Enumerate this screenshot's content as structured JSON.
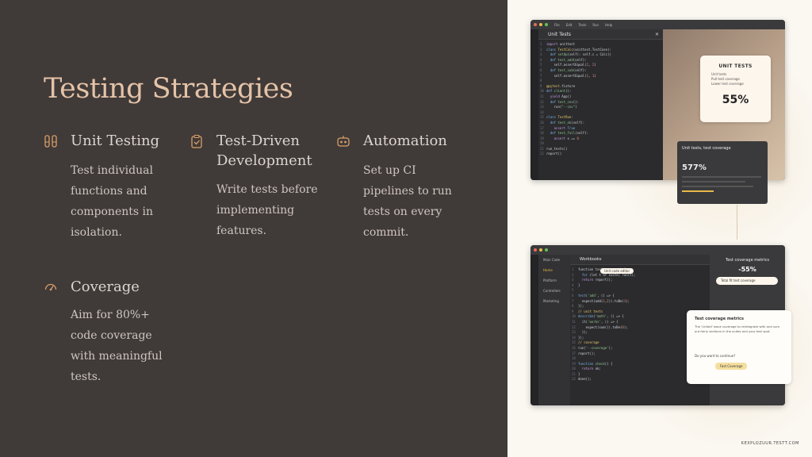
{
  "slide": {
    "title": "Testing Strategies",
    "features": [
      {
        "icon": "test-tubes-icon",
        "title": "Unit Testing",
        "lines": [
          "Test individual",
          "functions and",
          "components in",
          "isolation."
        ]
      },
      {
        "icon": "clipboard-check-icon",
        "title": "Test-Driven Development",
        "lines": [
          "Write tests before",
          "implementing",
          "features."
        ]
      },
      {
        "icon": "robot-icon",
        "title": "Automation",
        "lines": [
          "Set up CI",
          "pipelines to run",
          "tests on every",
          "commit."
        ]
      },
      {
        "icon": "gauge-icon",
        "title": "Coverage",
        "lines": [
          "Aim for 80%+",
          "code coverage",
          "with meaningful",
          "tests."
        ]
      }
    ]
  },
  "screenshot_top": {
    "menu": [
      "File",
      "Edit",
      "Tests",
      "Run",
      "Help"
    ],
    "panel_title": "Unit Tests",
    "coverage_card": {
      "title": "UNIT TESTS",
      "items": [
        "Unit tests",
        "Pull test coverage",
        "Lower test coverage"
      ],
      "value": "55%"
    },
    "tooltip": {
      "text": "Unit tests, test coverage",
      "value": "577%"
    }
  },
  "screenshot_bottom": {
    "sidebar": [
      "Main Code",
      "Home",
      "Platform",
      "Controllers",
      "Marketing"
    ],
    "tab": "Workbooks",
    "highlight_chip": "Unit code editor",
    "metrics_panel": {
      "title": "Test coverage metrics",
      "value": "-55%",
      "chip": "Total fit test coverage"
    },
    "dialog": {
      "title": "Test coverage metrics",
      "body": "The 'Unfold' wave coverage to reintegrate with and sum out fairly sections in the suites and your test spot.",
      "question": "Do you want to continue?",
      "button": "Fast Coverage"
    }
  },
  "watermark": "KEXPLOZUUR.TESTT.COM",
  "colors": {
    "left_bg": "#403a38",
    "title": "#e4c3a8",
    "right_bg": "#fbf8f2",
    "accent": "#e8b84a"
  }
}
